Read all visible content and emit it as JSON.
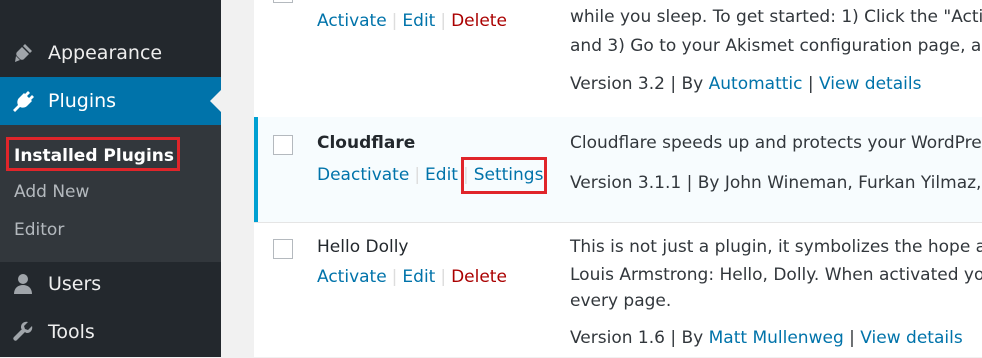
{
  "sidebar": {
    "appearance": {
      "label": "Appearance",
      "icon": "brush-icon"
    },
    "plugins": {
      "label": "Plugins",
      "icon": "plug-icon"
    },
    "submenu": {
      "installed_plugins": "Installed Plugins",
      "add_new": "Add New",
      "editor": "Editor"
    },
    "users": {
      "label": "Users",
      "icon": "users-icon"
    },
    "tools": {
      "label": "Tools",
      "icon": "wrench-icon"
    }
  },
  "plugins": {
    "akismet": {
      "actions": {
        "activate": "Activate",
        "edit": "Edit",
        "delete": "Delete"
      },
      "desc_line1": "while you sleep. To get started: 1) Click the \"Activ",
      "desc_line2": "and 3) Go to your Akismet configuration page, ar",
      "version": "Version 3.2",
      "by": "By",
      "author": "Automattic",
      "view_details": "View details"
    },
    "cloudflare": {
      "name": "Cloudflare",
      "actions": {
        "deactivate": "Deactivate",
        "edit": "Edit",
        "settings": "Settings"
      },
      "desc_line1": "Cloudflare speeds up and protects your WordPre",
      "meta": "Version 3.1.1 | By John Wineman, Furkan Yilmaz,"
    },
    "hello_dolly": {
      "name": "Hello Dolly",
      "actions": {
        "activate": "Activate",
        "edit": "Edit",
        "delete": "Delete"
      },
      "desc_line1": "This is not just a plugin, it symbolizes the hope ar",
      "desc_line2": "Louis Armstrong: Hello, Dolly. When activated yo",
      "desc_line3": "every page.",
      "version": "Version 1.6",
      "by": "By",
      "author": "Matt Mullenweg",
      "view_details": "View details"
    }
  },
  "colors": {
    "sidebar_bg": "#23282d",
    "active_bg": "#0073aa",
    "link": "#0073aa",
    "delete": "#aa0000",
    "highlight_border": "#e0252a"
  }
}
